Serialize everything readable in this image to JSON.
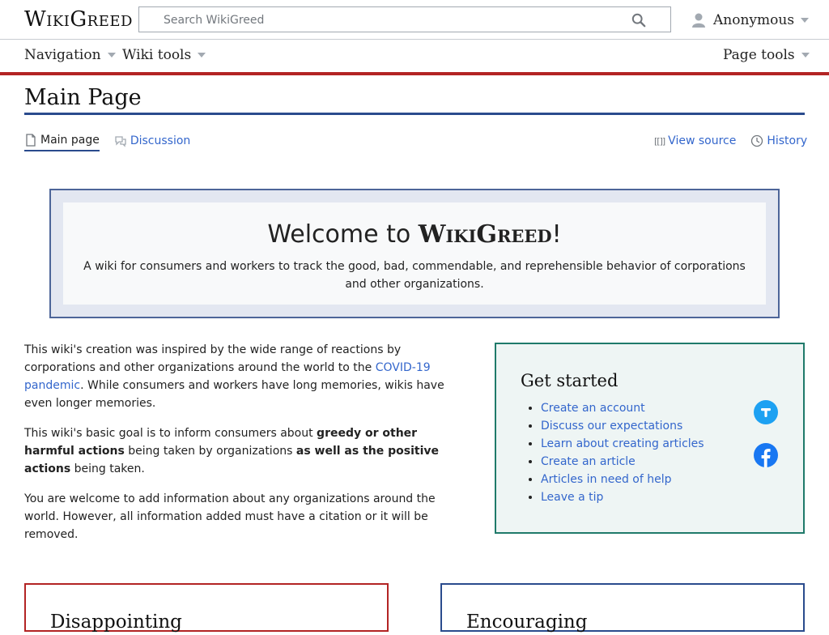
{
  "site": {
    "name": "WikiGreed"
  },
  "search": {
    "placeholder": "Search WikiGreed",
    "icon": "search-icon"
  },
  "user": {
    "name": "Anonymous",
    "icon": "user-icon"
  },
  "nav": {
    "navigation_label": "Navigation",
    "wiki_tools_label": "Wiki tools",
    "page_tools_label": "Page tools"
  },
  "page": {
    "title": "Main Page"
  },
  "tabs": {
    "main_page": "Main page",
    "discussion": "Discussion",
    "view_source": "View source",
    "history": "History"
  },
  "welcome": {
    "prefix": "Welcome to ",
    "brand": "WikiGreed",
    "suffix": "!",
    "description": "A wiki for consumers and workers to track the good, bad, commendable, and reprehensible behavior of corporations and other organizations."
  },
  "intro": {
    "p1_before": "This wiki's creation was inspired by the wide range of reactions by corporations and other organizations around the world to the ",
    "p1_link": "COVID-19 pandemic",
    "p1_after": ". While consumers and workers have long memories, wikis have even longer memories.",
    "p2_a": "This wiki's basic goal is to inform consumers about ",
    "p2_b": "greedy or other harmful actions",
    "p2_c": " being taken by organizations ",
    "p2_d": "as well as the positive actions",
    "p2_e": " being taken.",
    "p3": "You are welcome to add information about any organizations around the world. However, all information added must have a citation or it will be removed."
  },
  "get_started": {
    "title": "Get started",
    "items": [
      "Create an account",
      "Discuss our expectations",
      "Learn about creating articles",
      "Create an article",
      "Articles in need of help",
      "Leave a tip"
    ]
  },
  "social": {
    "twitter_icon": "twitter-icon",
    "facebook_icon": "facebook-icon"
  },
  "boxes": {
    "left_title": "Disappointing",
    "right_title": "Encouraging"
  },
  "colors": {
    "link": "#3366cc",
    "accent_red": "#b32424",
    "accent_blue": "#2a4b8d",
    "started_border": "#1f7a6a",
    "twitter": "#1da1f2",
    "facebook": "#1877f2"
  }
}
